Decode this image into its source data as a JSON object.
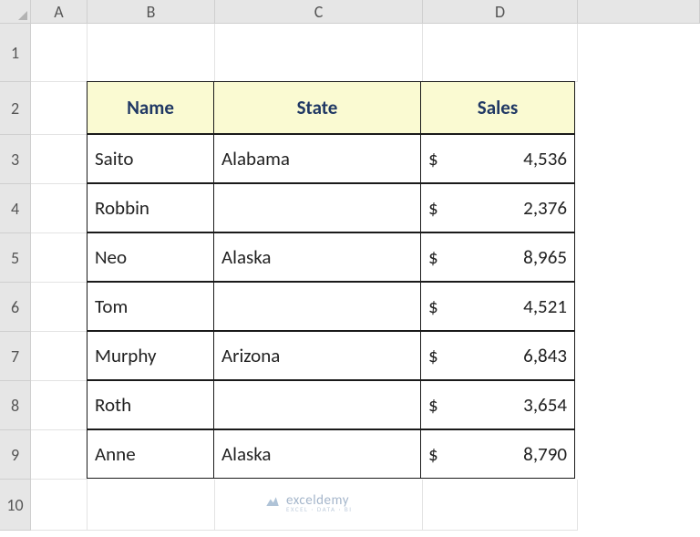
{
  "columns": [
    "A",
    "B",
    "C",
    "D"
  ],
  "rows": [
    "1",
    "2",
    "3",
    "4",
    "5",
    "6",
    "7",
    "8",
    "9",
    "10"
  ],
  "header": {
    "name": "Name",
    "state": "State",
    "sales": "Sales"
  },
  "data": [
    {
      "name": "Saito",
      "state": "Alabama",
      "sales": "4,536"
    },
    {
      "name": "Robbin",
      "state": "",
      "sales": "2,376"
    },
    {
      "name": "Neo",
      "state": "Alaska",
      "sales": "8,965"
    },
    {
      "name": "Tom",
      "state": "",
      "sales": "4,521"
    },
    {
      "name": "Murphy",
      "state": "Arizona",
      "sales": "6,843"
    },
    {
      "name": "Roth",
      "state": "",
      "sales": "3,654"
    },
    {
      "name": "Anne",
      "state": "Alaska",
      "sales": "8,790"
    }
  ],
  "currency": "$",
  "watermark": {
    "brand": "exceldemy",
    "tagline": "EXCEL · DATA · BI"
  },
  "chart_data": {
    "type": "table",
    "columns": [
      "Name",
      "State",
      "Sales"
    ],
    "rows": [
      [
        "Saito",
        "Alabama",
        4536
      ],
      [
        "Robbin",
        "",
        2376
      ],
      [
        "Neo",
        "Alaska",
        8965
      ],
      [
        "Tom",
        "",
        4521
      ],
      [
        "Murphy",
        "Arizona",
        6843
      ],
      [
        "Roth",
        "",
        3654
      ],
      [
        "Anne",
        "Alaska",
        8790
      ]
    ]
  }
}
